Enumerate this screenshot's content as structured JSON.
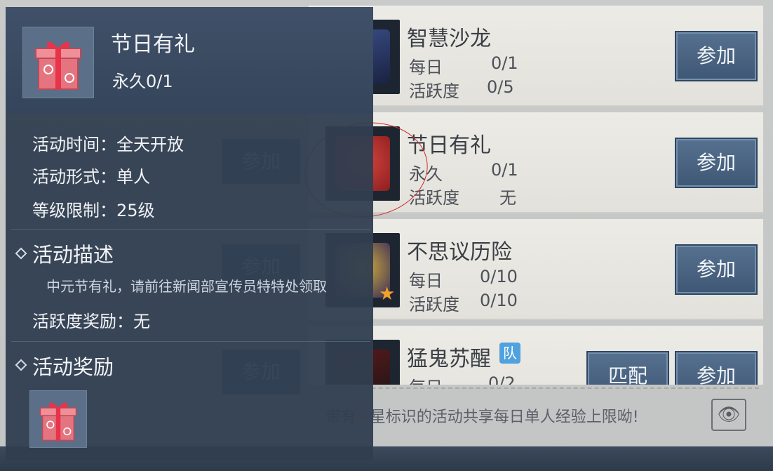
{
  "activities": [
    {
      "name": "智慧沙龙",
      "label1": "每日",
      "value1": "0/1",
      "label2": "活跃度",
      "value2": "0/5",
      "button": "参加"
    },
    {
      "name": "节日有礼",
      "label1": "永久",
      "value1": "0/1",
      "label2": "活跃度",
      "value2": "无",
      "button": "参加"
    },
    {
      "name": "不思议历险",
      "label1": "每日",
      "value1": "0/10",
      "label2": "活跃度",
      "value2": "0/10",
      "button": "参加"
    },
    {
      "name": "猛鬼苏醒",
      "badge": "队",
      "label1": "每日",
      "value1": "0/2",
      "button": "参加",
      "button2": "匹配"
    }
  ],
  "left_ghost_buttons": [
    "参加",
    "参加",
    "参加",
    "参加"
  ],
  "footer": {
    "prefix": "带有",
    "suffix": "星标识的活动共享每日单人经验上限呦!"
  },
  "popup": {
    "title": "节日有礼",
    "count": "永久0/1",
    "time": "活动时间：全天开放",
    "form": "活动形式：单人",
    "level": "等级限制：25级",
    "desc_title": "活动描述",
    "desc": "中元节有礼，请前往新闻部宣传员特特处领取",
    "activity_reward": "活跃度奖励：无",
    "reward_title": "活动奖励"
  },
  "colors": {
    "accent_button": "#4b6483",
    "popup_bg": "#303e50",
    "annotation": "#d22a2a",
    "star": "#f2a12a"
  }
}
